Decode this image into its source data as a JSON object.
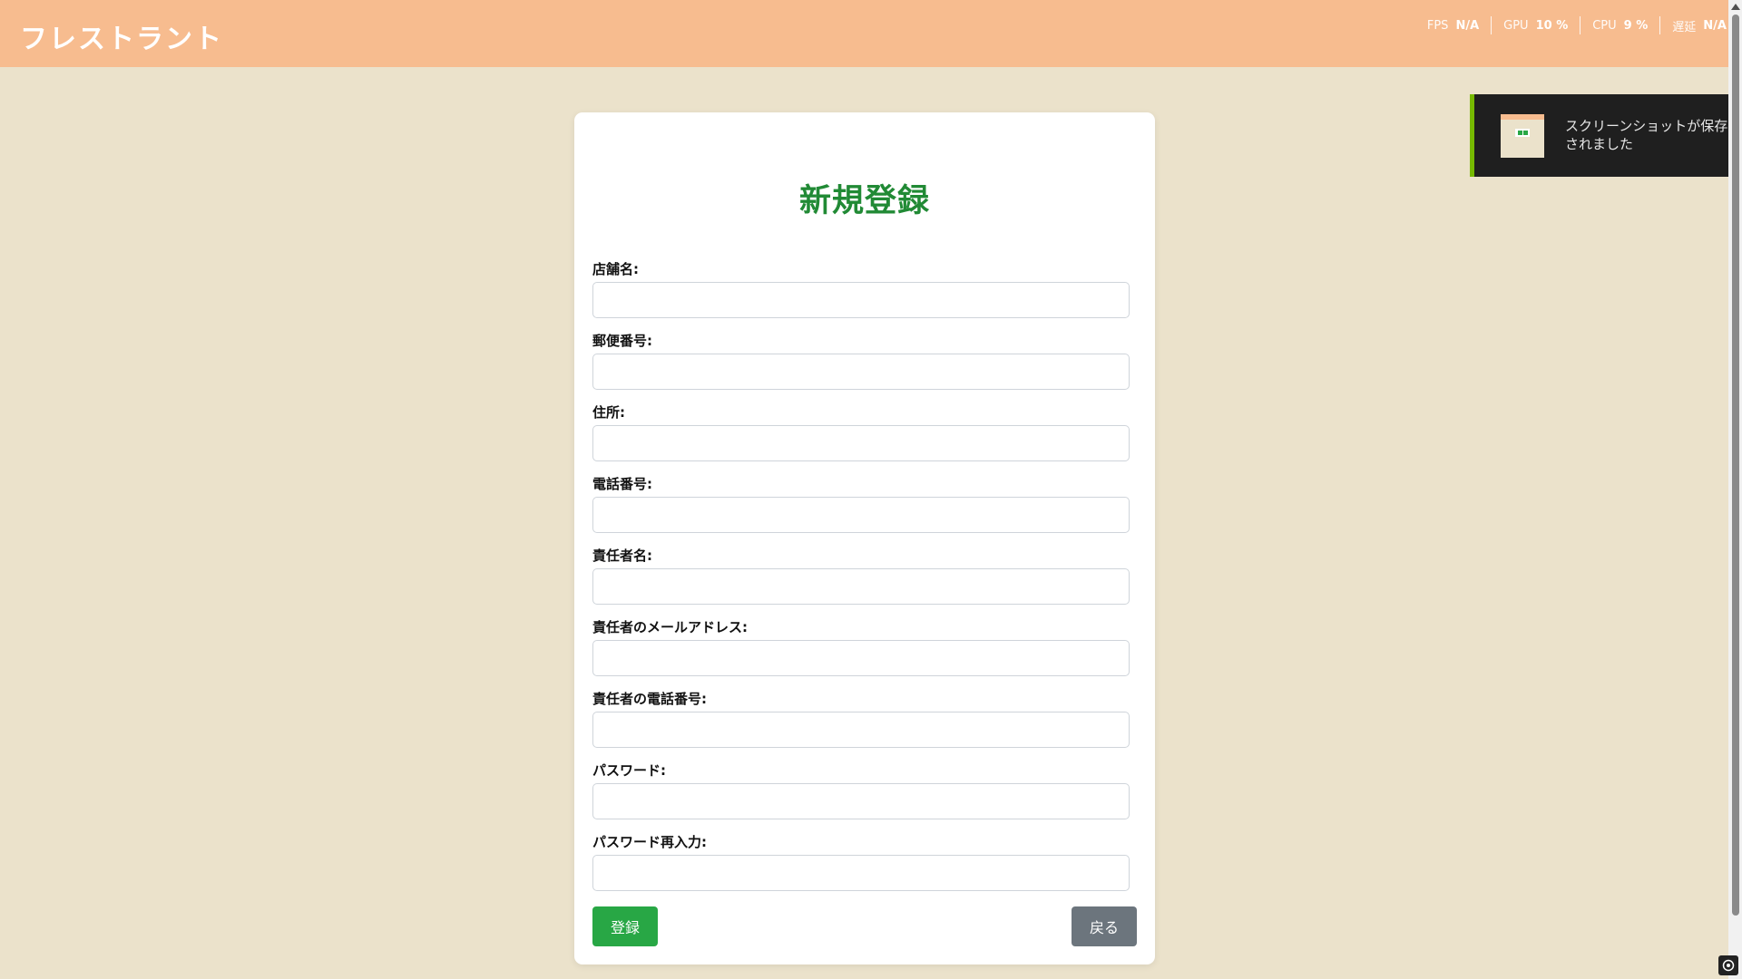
{
  "header": {
    "brand": "フレストラント",
    "stats": [
      {
        "key": "FPS",
        "value": "N/A"
      },
      {
        "key": "GPU",
        "value": "10 %"
      },
      {
        "key": "CPU",
        "value": "9 %"
      },
      {
        "key": "遅延",
        "value": "N/A"
      }
    ]
  },
  "toast": {
    "message": "スクリーンショットが保存されました"
  },
  "form": {
    "title": "新規登録",
    "fields": [
      {
        "label": "店舗名:"
      },
      {
        "label": "郵便番号:"
      },
      {
        "label": "住所:"
      },
      {
        "label": "電話番号:"
      },
      {
        "label": "責任者名:"
      },
      {
        "label": "責任者のメールアドレス:"
      },
      {
        "label": "責任者の電話番号:"
      },
      {
        "label": "パスワード:"
      },
      {
        "label": "パスワード再入力:"
      }
    ],
    "submit_label": "登録",
    "back_label": "戻る"
  },
  "colors": {
    "header": "#f7bc8f",
    "background": "#ebe2cb",
    "title": "#218a35",
    "submit": "#28a745",
    "back": "#6c757d",
    "toast_accent": "#76b900"
  }
}
